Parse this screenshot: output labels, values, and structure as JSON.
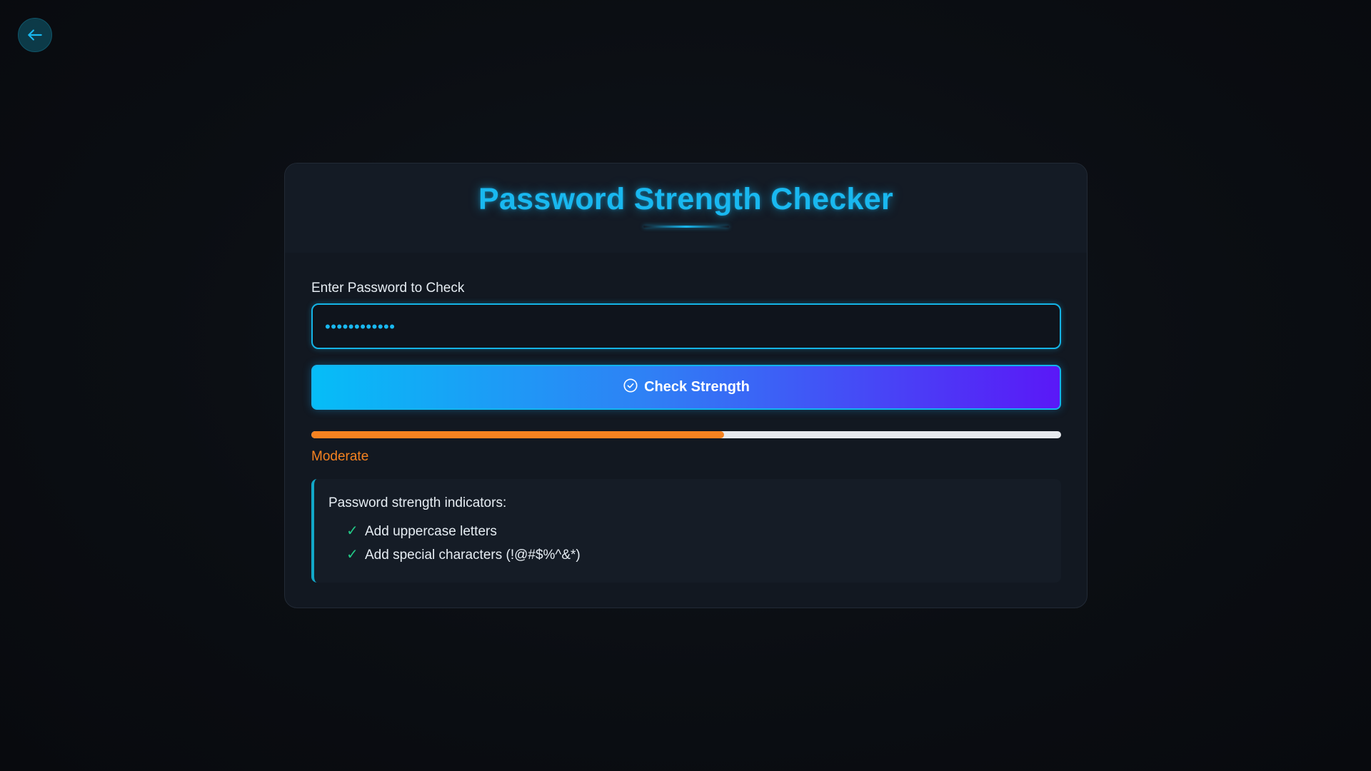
{
  "page": {
    "title": "Password Strength Checker"
  },
  "form": {
    "label": "Enter Password to Check",
    "password_masked": "••••••••••••",
    "button_label": "Check Strength"
  },
  "strength": {
    "label": "Moderate",
    "fraction": 0.55,
    "color": "#f58220"
  },
  "indicators": {
    "title": "Password strength indicators:",
    "items": [
      {
        "mark": "✓",
        "text": "Add uppercase letters"
      },
      {
        "mark": "✓",
        "text": "Add special characters (!@#$%^&*)"
      }
    ]
  },
  "icons": {
    "back": "arrow-left-icon",
    "button": "check-circle-icon"
  },
  "colors": {
    "accent": "#19b8f0",
    "button_gradient_start": "#06bdf7",
    "button_gradient_end": "#5a18f7",
    "check_mark": "#22c987"
  }
}
